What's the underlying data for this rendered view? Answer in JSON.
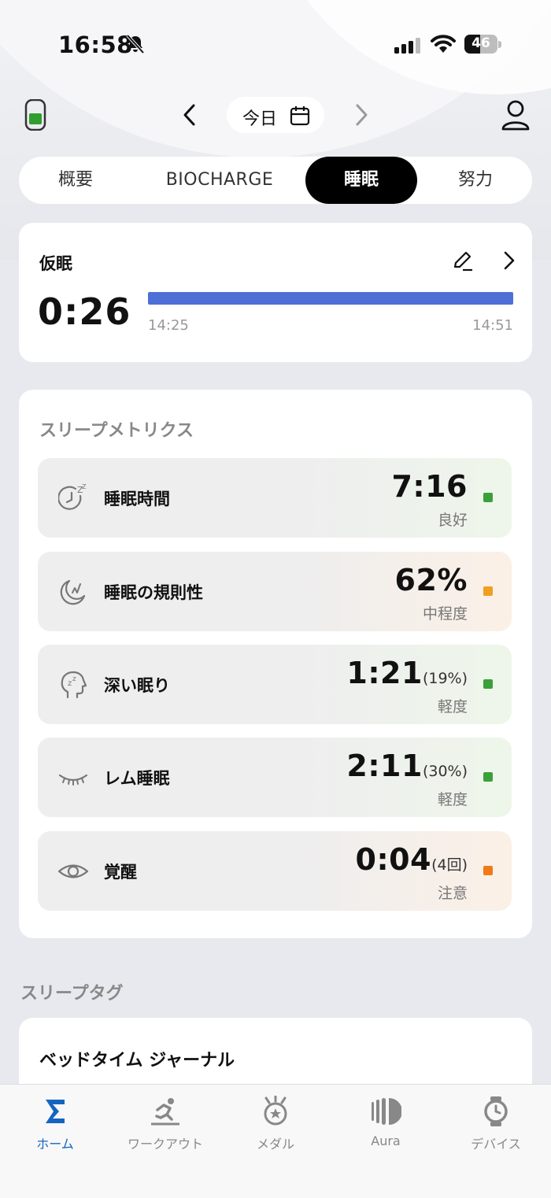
{
  "status_bar": {
    "time": "16:58",
    "battery": "46"
  },
  "header": {
    "date_label": "今日"
  },
  "tabs": [
    {
      "label": "概要"
    },
    {
      "label": "BIOCHARGE"
    },
    {
      "label": "睡眠"
    },
    {
      "label": "努力"
    }
  ],
  "nap": {
    "title": "仮眠",
    "duration": "0:26",
    "start_time": "14:25",
    "end_time": "14:51"
  },
  "metrics": {
    "title": "スリープメトリクス",
    "items": [
      {
        "label": "睡眠時間",
        "value": "7:16",
        "extra": "",
        "status": "良好",
        "icon": "sleep-duration-icon",
        "dot_color": "#3aa03a"
      },
      {
        "label": "睡眠の規則性",
        "value": "62%",
        "extra": "",
        "status": "中程度",
        "icon": "moon-star-icon",
        "dot_color": "#f0a020"
      },
      {
        "label": "深い眠り",
        "value": "1:21",
        "extra": "(19%)",
        "status": "軽度",
        "icon": "head-zzz-icon",
        "dot_color": "#3aa03a"
      },
      {
        "label": "レム睡眠",
        "value": "2:11",
        "extra": "(30%)",
        "status": "軽度",
        "icon": "closed-eye-icon",
        "dot_color": "#3aa03a"
      },
      {
        "label": "覚醒",
        "value": "0:04",
        "extra": "(4回)",
        "status": "注意",
        "icon": "eye-icon",
        "dot_color": "#f07a1a"
      }
    ]
  },
  "tags": {
    "title": "スリープタグ",
    "journal_title": "ベッドタイム ジャーナル"
  },
  "bottom_nav": [
    {
      "label": "ホーム",
      "icon": "sigma-icon"
    },
    {
      "label": "ワークアウト",
      "icon": "runner-icon"
    },
    {
      "label": "メダル",
      "icon": "medal-icon"
    },
    {
      "label": "Aura",
      "icon": "aura-icon"
    },
    {
      "label": "デバイス",
      "icon": "watch-icon"
    }
  ],
  "colors": {
    "accent": "#1565c0",
    "nap_bar": "#4e6fd6",
    "good": "#3aa03a",
    "moderate": "#f0a020",
    "caution": "#f07a1a"
  }
}
